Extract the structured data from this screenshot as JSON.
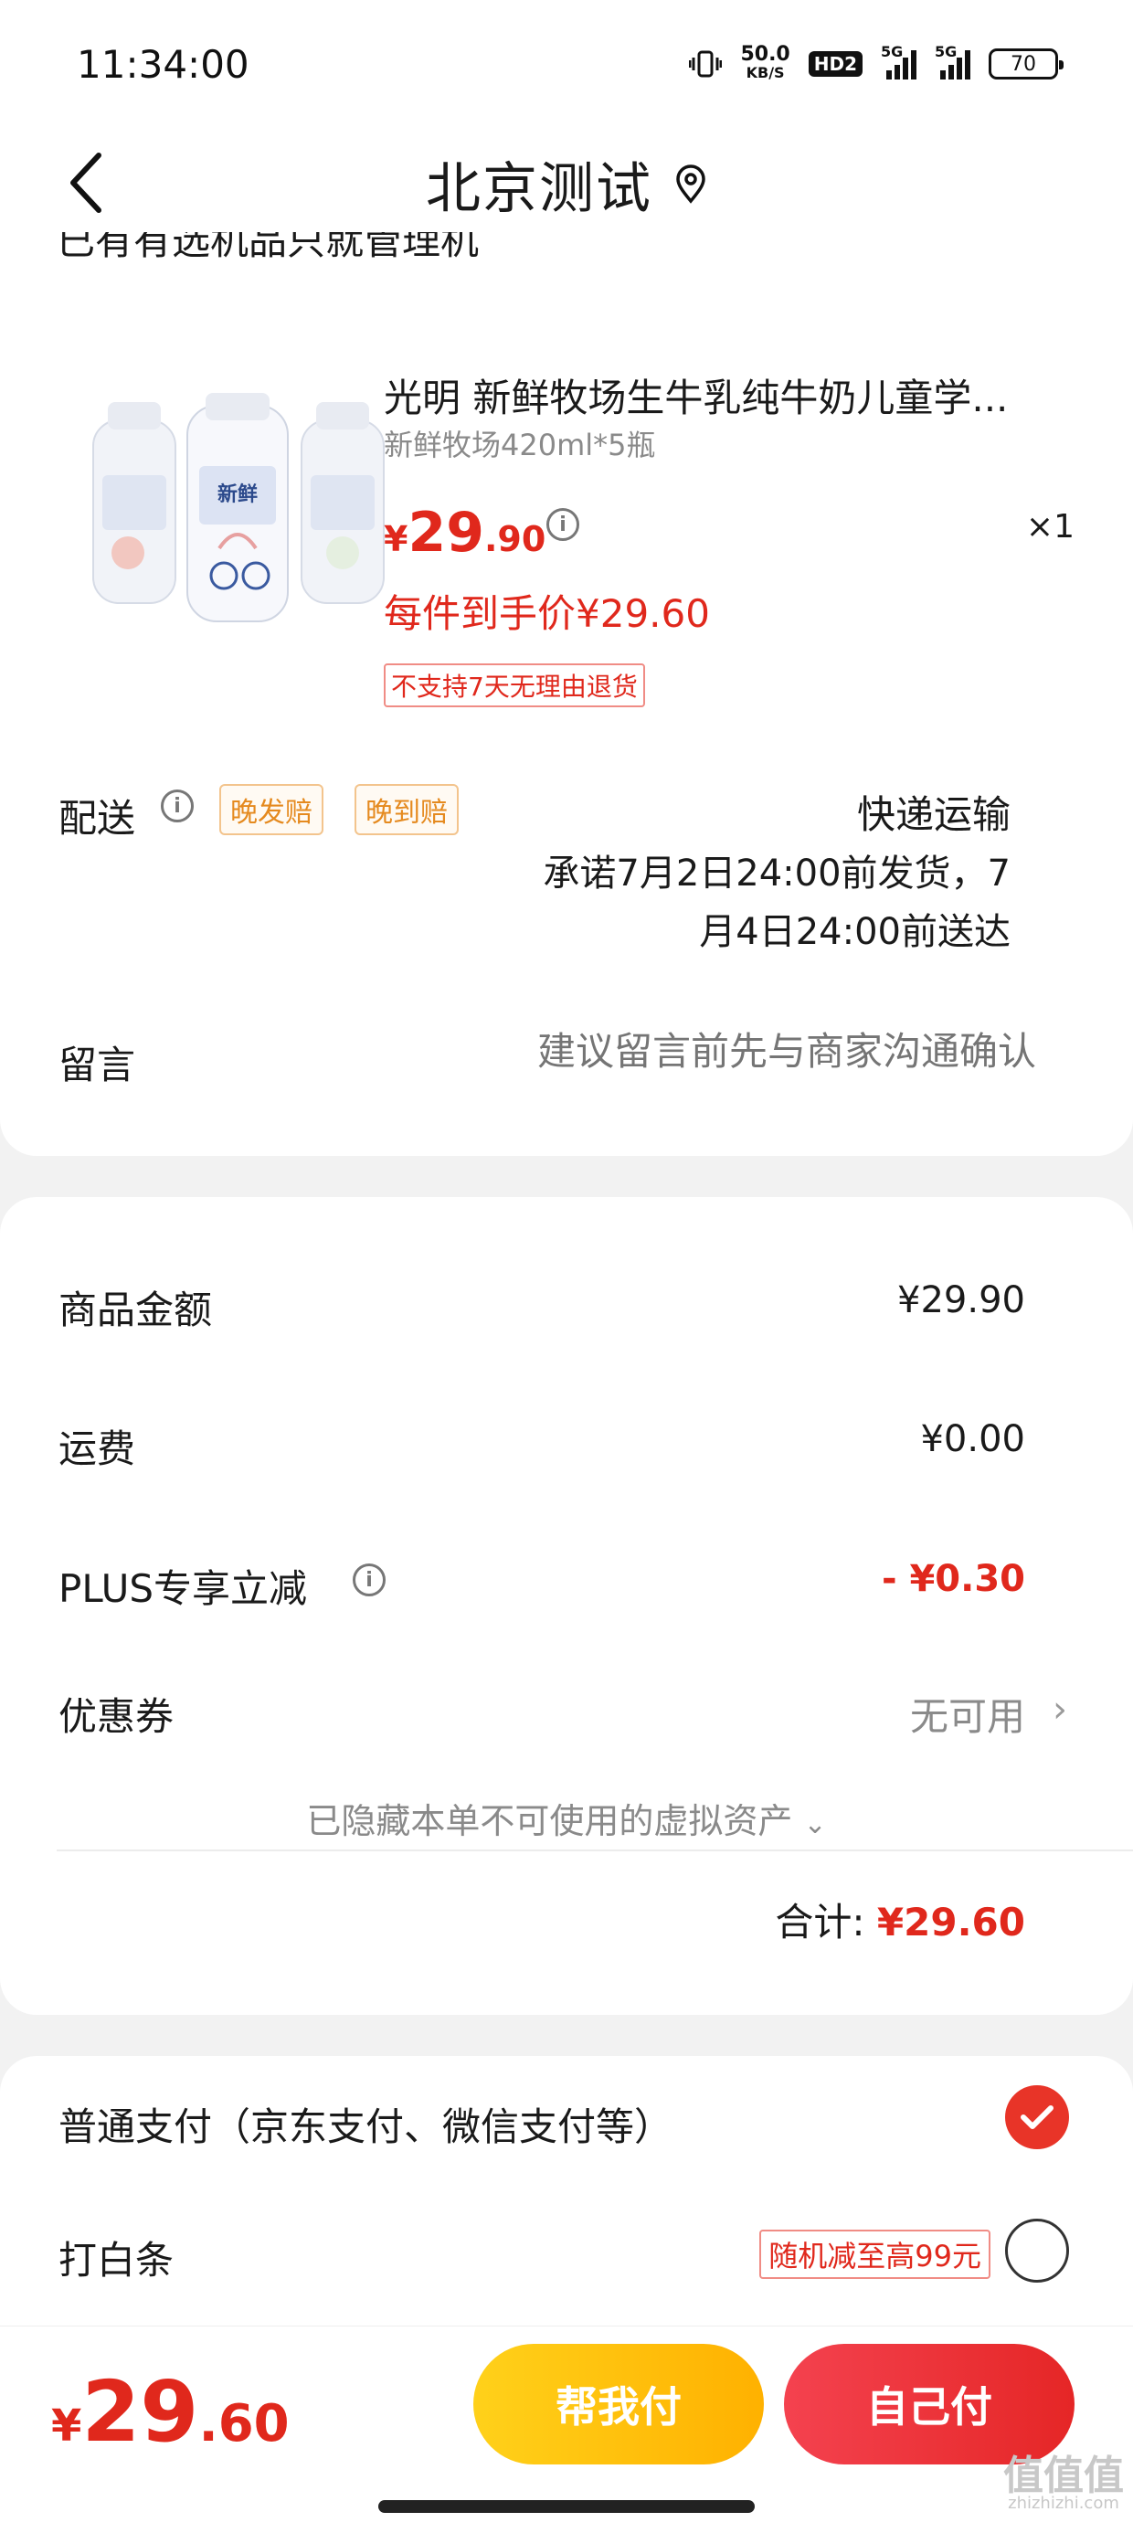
{
  "status_bar": {
    "time": "11:34:00",
    "net_speed": "50.0",
    "net_unit": "KB/S",
    "hd": "HD2",
    "sig1": "5G",
    "sig2": "5G",
    "battery": "70"
  },
  "header": {
    "title": "北京测试",
    "back_icon": "chevron-left-icon",
    "location_icon": "location-pin-icon"
  },
  "store": {
    "cut_text": "已有有选机品只就管理机"
  },
  "product": {
    "name": "光明 新鲜牧场生牛乳纯牛奶儿童学...",
    "spec": "新鲜牧场420ml*5瓶",
    "price_symbol": "¥",
    "price_int": "29",
    "price_dec": ".90",
    "quantity": "×1",
    "per_item_price": "每件到手价¥29.60",
    "no_return": "不支持7天无理由退货"
  },
  "delivery": {
    "label": "配送",
    "tag_late_ship": "晚发赔",
    "tag_late_arrive": "晚到赔",
    "type": "快递运输",
    "promise_line1": "承诺7月2日24:00前发货，7",
    "promise_line2": "月4日24:00前送达"
  },
  "message": {
    "label": "留言",
    "placeholder": "建议留言前先与商家沟通确认"
  },
  "summary": {
    "goods_label": "商品金额",
    "goods_value": "¥29.90",
    "shipping_label": "运费",
    "shipping_value": "¥0.00",
    "plus_label": "PLUS专享立减",
    "plus_value": "- ¥0.30",
    "coupon_label": "优惠券",
    "coupon_value": "无可用",
    "hidden_assets": "已隐藏本单不可使用的虚拟资产",
    "total_label": "合计:",
    "total_value": "¥29.60"
  },
  "payment": {
    "normal_label": "普通支付（京东支付、微信支付等）",
    "normal_selected": true,
    "baitiao_label": "打白条",
    "baitiao_tag": "随机减至高99元",
    "baitiao_selected": false
  },
  "bottom": {
    "price_symbol": "¥",
    "price_int": "29",
    "price_dec": ".60",
    "help_pay": "帮我付",
    "self_pay": "自己付"
  },
  "colors": {
    "accent_red": "#e0281c",
    "tag_orange": "#e58a1f",
    "help_button": "#ffc10a",
    "self_button": "#ea2d33"
  },
  "watermark": {
    "main": "值值值",
    "sub": "zhizhizhi.com"
  }
}
